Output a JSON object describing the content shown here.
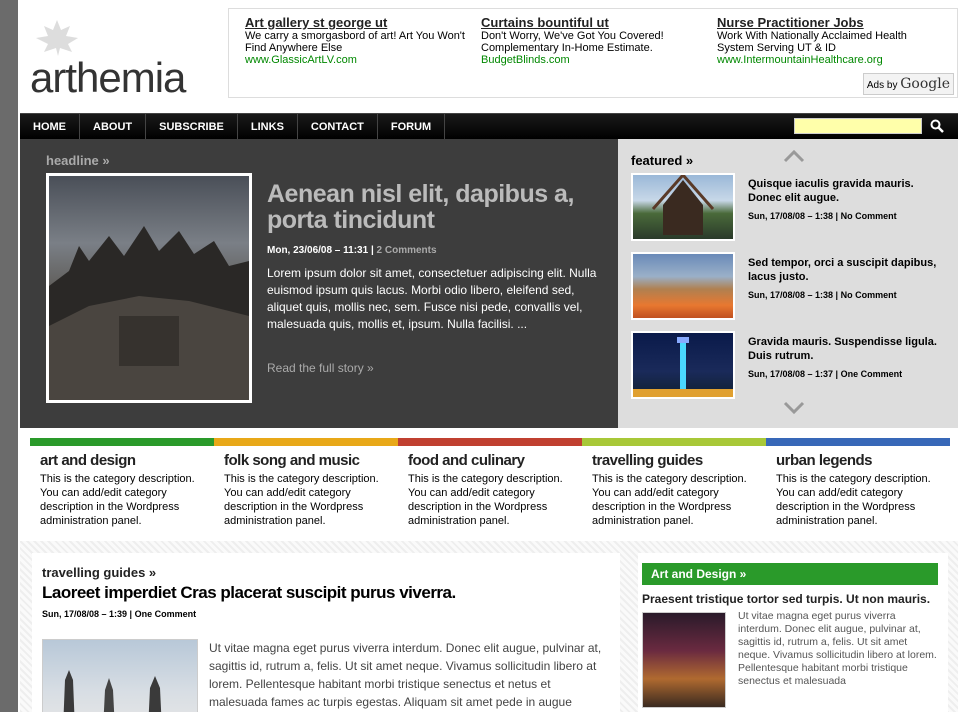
{
  "logo": {
    "text": "arthemia"
  },
  "ads": [
    {
      "title": "Art gallery st george ut",
      "text": "We carry a smorgasbord of art! Art You Won't Find Anywhere Else",
      "url": "www.GlassicArtLV.com"
    },
    {
      "title": "Curtains bountiful ut",
      "text": "Don't Worry, We've Got You Covered! Complementary In-Home Estimate.",
      "url": "BudgetBlinds.com"
    },
    {
      "title": "Nurse Practitioner Jobs",
      "text": "Work With Nationally Acclaimed Health System Serving UT & ID",
      "url": "www.IntermountainHealthcare.org"
    }
  ],
  "adsby": {
    "label": "Ads by",
    "brand": "Google"
  },
  "nav": [
    "HOME",
    "ABOUT",
    "SUBSCRIBE",
    "LINKS",
    "CONTACT",
    "FORUM"
  ],
  "search": {
    "placeholder": ""
  },
  "headline": {
    "label": "headline »",
    "title": "Aenean nisl elit, dapibus a, porta tincidunt",
    "date": "Mon, 23/06/08 – 11:31 |",
    "comments": "2 Comments",
    "text": "Lorem ipsum dolor sit amet, consectetuer adipiscing elit. Nulla euismod ipsum quis lacus. Morbi odio libero, eleifend sed, aliquet quis, mollis nec, sem. Fusce nisi pede, convallis vel, malesuada quis, mollis et, ipsum. Nulla facilisi. ...",
    "more": "Read the full story »"
  },
  "featured": {
    "label": "featured »",
    "items": [
      {
        "title": "Quisque iaculis gravida mauris. Donec elit augue.",
        "date": "Sun, 17/08/08 – 1:38 |",
        "comments": "No Comment"
      },
      {
        "title": "Sed tempor, orci a suscipit dapibus, lacus justo.",
        "date": "Sun, 17/08/08 – 1:38 |",
        "comments": "No Comment"
      },
      {
        "title": "Gravida mauris. Suspendisse ligula. Duis rutrum.",
        "date": "Sun, 17/08/08 – 1:37 |",
        "comments": "One Comment"
      }
    ]
  },
  "categories": [
    {
      "title": "art and design",
      "desc": "This is the category description. You can add/edit category description in the Wordpress administration panel.",
      "color": "#2a9a2a"
    },
    {
      "title": "folk song and music",
      "desc": "This is the category description. You can add/edit category description in the Wordpress administration panel.",
      "color": "#e8a818"
    },
    {
      "title": "food and culinary",
      "desc": "This is the category description. You can add/edit category description in the Wordpress administration panel.",
      "color": "#c04030"
    },
    {
      "title": "travelling guides",
      "desc": "This is the category description. You can add/edit category description in the Wordpress administration panel.",
      "color": "#a8c838"
    },
    {
      "title": "urban legends",
      "desc": "This is the category description. You can add/edit category description in the Wordpress administration panel.",
      "color": "#3868b8"
    }
  ],
  "post": {
    "category": "travelling guides »",
    "title": "Laoreet imperdiet Cras placerat suscipit purus viverra.",
    "date": "Sun, 17/08/08 – 1:39 |",
    "comments": "One Comment",
    "text": "Ut vitae magna eget purus viverra interdum. Donec elit augue, pulvinar at, sagittis id, rutrum a, felis. Ut sit amet neque. Vivamus sollicitudin libero at lorem. Pellentesque habitant morbi tristique senectus et netus et malesuada fames ac turpis egestas. Aliquam sit amet pede in augue"
  },
  "side": {
    "head": "Art and Design »",
    "title": "Praesent tristique tortor sed turpis. Ut non mauris.",
    "text": "Ut vitae magna eget purus viverra interdum. Donec elit augue, pulvinar at, sagittis id, rutrum a, felis. Ut sit amet neque. Vivamus sollicitudin libero at lorem. Pellentesque habitant morbi tristique senectus et malesuada"
  }
}
